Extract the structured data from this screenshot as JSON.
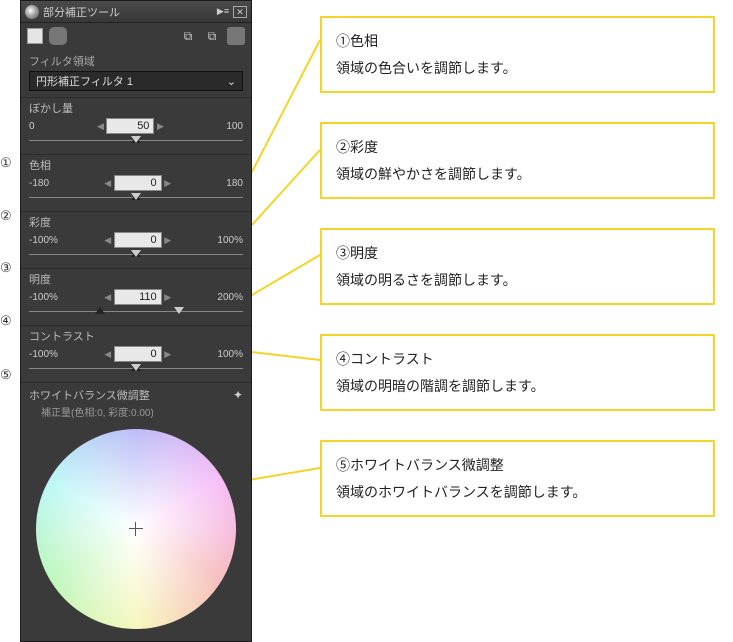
{
  "panel": {
    "title": "部分補正ツール",
    "filter_section_label": "フィルタ領域",
    "filter_dropdown_value": "円形補正フィルタ 1",
    "blur": {
      "label": "ぼかし量",
      "min": "0",
      "value": "50",
      "max": "100"
    },
    "hue": {
      "label": "色相",
      "min": "-180",
      "value": "0",
      "max": "180"
    },
    "saturation": {
      "label": "彩度",
      "min": "-100%",
      "value": "0",
      "max": "100%"
    },
    "brightness": {
      "label": "明度",
      "min": "-100%",
      "value": "110",
      "max": "200%"
    },
    "contrast": {
      "label": "コントラスト",
      "min": "-100%",
      "value": "0",
      "max": "100%"
    },
    "wb": {
      "label": "ホワイトバランス微調整",
      "sub": "補正量(色相:0, 彩度:0.00)"
    }
  },
  "markers": {
    "m1": "①",
    "m2": "②",
    "m3": "③",
    "m4": "④",
    "m5": "⑤"
  },
  "callouts": {
    "c1": {
      "title": "①色相",
      "body": "領域の色合いを調節します。"
    },
    "c2": {
      "title": "②彩度",
      "body": "領域の鮮やかさを調節します。"
    },
    "c3": {
      "title": "③明度",
      "body": "領域の明るさを調節します。"
    },
    "c4": {
      "title": "④コントラスト",
      "body": "領域の明暗の階調を調節します。"
    },
    "c5": {
      "title": "⑤ホワイトバランス微調整",
      "body": "領域のホワイトバランスを調節します。"
    }
  }
}
